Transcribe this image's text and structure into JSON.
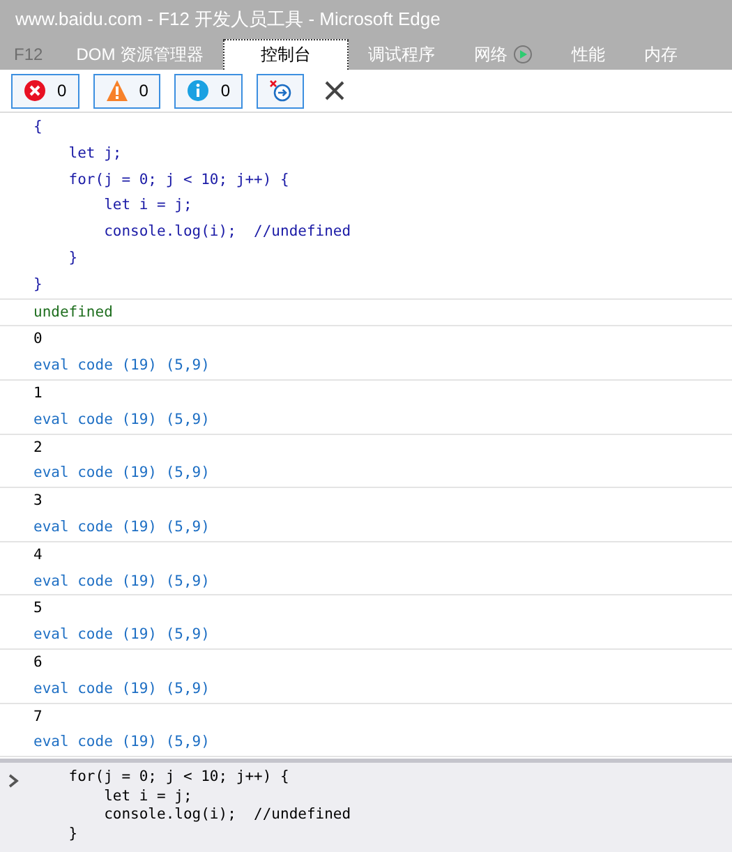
{
  "window": {
    "title": "www.baidu.com - F12 开发人员工具 - Microsoft Edge"
  },
  "tabs": [
    {
      "label": "F12",
      "selected": false,
      "disabled": true
    },
    {
      "label": "DOM 资源管理器",
      "selected": false,
      "disabled": false
    },
    {
      "label": "控制台",
      "selected": true,
      "disabled": false
    },
    {
      "label": "调试程序",
      "selected": false,
      "disabled": false
    },
    {
      "label": "网络",
      "selected": false,
      "disabled": false,
      "kind": "play"
    },
    {
      "label": "性能",
      "selected": false,
      "disabled": false
    },
    {
      "label": "内存",
      "selected": false,
      "disabled": false
    }
  ],
  "toolbar": [
    {
      "kind": "error",
      "count": "0"
    },
    {
      "kind": "warning",
      "count": "0"
    },
    {
      "kind": "info",
      "count": "0"
    },
    {
      "kind": "clear-on-navigate"
    },
    {
      "kind": "clear"
    }
  ],
  "console": [
    {
      "kind": "echo",
      "lines": [
        "{",
        "    let j;",
        "    for(j = 0; j < 10; j++) {",
        "        let i = j;",
        "        console.log(i);  //undefined",
        "    }",
        "}"
      ]
    },
    {
      "kind": "result",
      "text": "undefined"
    },
    {
      "kind": "log",
      "text": "0",
      "source": "eval code (19) (5,9)"
    },
    {
      "kind": "log",
      "text": "1",
      "source": "eval code (19) (5,9)"
    },
    {
      "kind": "log",
      "text": "2",
      "source": "eval code (19) (5,9)"
    },
    {
      "kind": "log",
      "text": "3",
      "source": "eval code (19) (5,9)"
    },
    {
      "kind": "log",
      "text": "4",
      "source": "eval code (19) (5,9)"
    },
    {
      "kind": "log",
      "text": "5",
      "source": "eval code (19) (5,9)"
    },
    {
      "kind": "log",
      "text": "6",
      "source": "eval code (19) (5,9)"
    },
    {
      "kind": "log",
      "text": "7",
      "source": "eval code (19) (5,9)"
    }
  ],
  "input": {
    "lines": [
      "    for(j = 0; j < 10; j++) {",
      "        let i = j;",
      "        console.log(i);  //undefined",
      "    }"
    ]
  }
}
